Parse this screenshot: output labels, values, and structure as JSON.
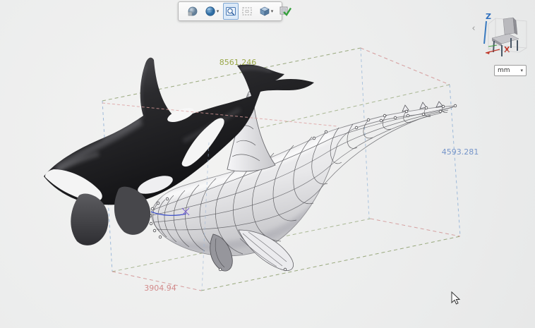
{
  "scene": {
    "description": "3D viewport with shaded orca model and wireframe whale model inside a dimensioned bounding box",
    "models": [
      "orca-shaded-model",
      "whale-wireframe-model"
    ],
    "measurements": {
      "length": {
        "value": "8561.246",
        "color": "#99a748"
      },
      "height": {
        "value": "4593.281",
        "color": "#7695c9"
      },
      "width": {
        "value": "3904.94",
        "color": "#d28a8a"
      }
    },
    "bounding_box_colors": {
      "length_edges": "#7d9258",
      "width_edges": "#d08d8d",
      "height_edges": "#8fb0d6"
    }
  },
  "toolbar": {
    "icons": [
      "sphere-shaded-icon",
      "sphere-render-mode-icon",
      "zoom-region-icon",
      "dashed-selection-box-icon",
      "view-cube-icon",
      "apply-check-icon"
    ],
    "active_icon": "zoom-region-icon"
  },
  "nav_widget": {
    "collapse_chevron": "‹",
    "z_axis_label": "Z",
    "x_axis_label": "X"
  },
  "units_dropdown": {
    "value": "mm"
  },
  "icons": {
    "caret_down": "▾"
  }
}
